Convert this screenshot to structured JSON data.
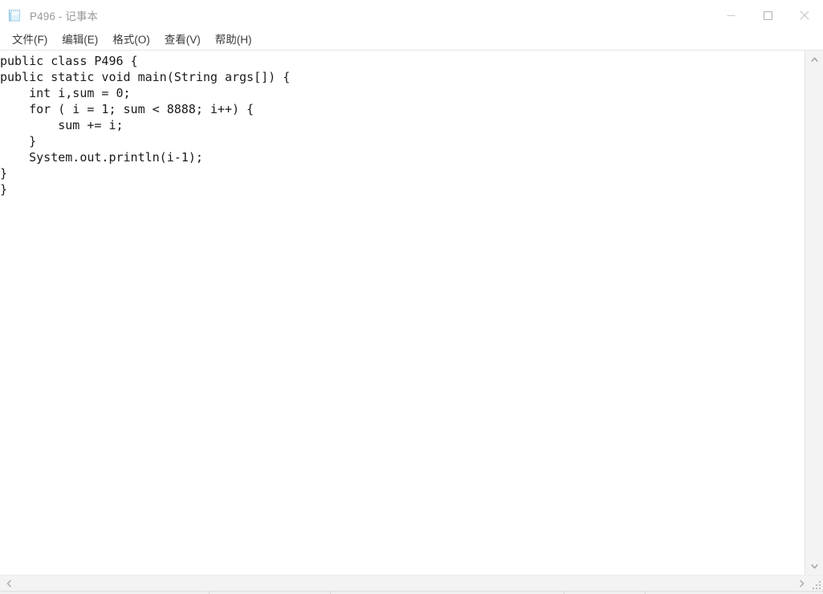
{
  "window": {
    "title": "P496 - 记事本",
    "app_icon": "notepad-icon",
    "controls": {
      "minimize_label": "—",
      "maximize_label": "□",
      "close_label": "✕"
    }
  },
  "menubar": {
    "items": [
      {
        "label": "文件(F)",
        "name": "file"
      },
      {
        "label": "编辑(E)",
        "name": "edit"
      },
      {
        "label": "格式(O)",
        "name": "format"
      },
      {
        "label": "查看(V)",
        "name": "view"
      },
      {
        "label": "帮助(H)",
        "name": "help"
      }
    ]
  },
  "editor": {
    "content": "public class P496 {\npublic static void main(String args[]) {\n    int i,sum = 0;\n    for ( i = 1; sum < 8888; i++) {\n        sum += i;\n    }\n    System.out.println(i-1);\n}\n}",
    "lines": [
      "public class P496 {",
      "public static void main(String args[]) {",
      "    int i,sum = 0;",
      "    for ( i = 1; sum < 8888; i++) {",
      "        sum += i;",
      "    }",
      "    System.out.println(i-1);",
      "}",
      "}"
    ]
  },
  "scrollbars": {
    "vertical": {
      "up_arrow": "chevron-up-icon",
      "down_arrow": "chevron-down-icon"
    },
    "horizontal": {
      "left_arrow": "chevron-left-icon",
      "right_arrow": "chevron-right-icon"
    },
    "resize_grip": "resize-grip-icon"
  },
  "colors": {
    "window_bg": "#ffffff",
    "title_text": "#9a9a9a",
    "menu_text": "#3b3b3b",
    "code_text": "#1a1a1a",
    "scrollbar_bg": "#f3f3f3",
    "icon_accent": "#a9d9ef"
  }
}
